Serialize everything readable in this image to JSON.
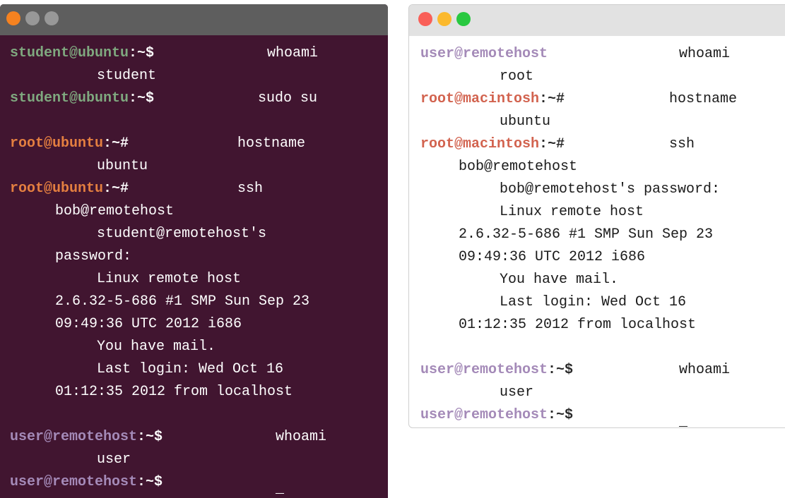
{
  "left": {
    "p1": {
      "user": "student@ubuntu",
      "sep": ":~$",
      "cmd": "whoami"
    },
    "out1": "student",
    "p2": {
      "user": "student@ubuntu",
      "sep": ":~$",
      "cmd": "sudo su"
    },
    "p3": {
      "user": "root@ubuntu",
      "sep": ":~#",
      "cmd": "hostname"
    },
    "out3": "ubuntu",
    "p4": {
      "user": "root@ubuntu",
      "sep": ":~#",
      "cmd": "ssh"
    },
    "cont4": "bob@remotehost",
    "out4a": "student@remotehost's",
    "out4b": "password:",
    "out4c": "Linux remote host",
    "out4d": "2.6.32-5-686 #1 SMP Sun Sep 23",
    "out4e": "09:49:36 UTC 2012 i686",
    "out4f": "You have mail.",
    "out4g": "Last login: Wed Oct 16",
    "out4h": "01:12:35 2012 from localhost",
    "p5": {
      "user": "user@remotehost",
      "sep": ":~$",
      "cmd": "whoami"
    },
    "out5": "user",
    "p6": {
      "user": "user@remotehost",
      "sep": ":~$",
      "cmd": "_"
    }
  },
  "right": {
    "p1": {
      "user": "user@remotehost",
      "sep": "",
      "cmd": "whoami"
    },
    "out1": "root",
    "p2": {
      "user": "root@macintosh",
      "sep": ":~#",
      "cmd": "hostname"
    },
    "out2": "ubuntu",
    "p3": {
      "user": "root@macintosh",
      "sep": ":~#",
      "cmd": "ssh"
    },
    "cont3": "bob@remotehost",
    "out3a": "bob@remotehost's password:",
    "out3b": "Linux remote host",
    "out3c": "2.6.32-5-686 #1 SMP Sun Sep 23",
    "out3d": "09:49:36 UTC 2012 i686",
    "out3e": "You have mail.",
    "out3f": "Last login: Wed Oct 16",
    "out3g": "01:12:35 2012 from localhost",
    "p4": {
      "user": "user@remotehost",
      "sep": ":~$",
      "cmd": "whoami"
    },
    "out4": "user",
    "p5": {
      "user": "user@remotehost",
      "sep": ":~$",
      "cmd": "_"
    }
  }
}
